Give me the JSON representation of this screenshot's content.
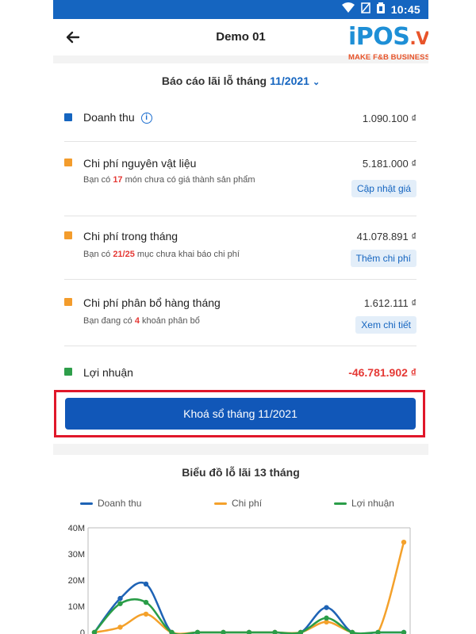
{
  "status_bar": {
    "time": "10:45"
  },
  "app_bar": {
    "title": "Demo 01"
  },
  "brand": {
    "logo_i": "i",
    "logo_pos": "POS",
    "logo_vn": ".VN",
    "tagline": "MAKE F&B BUSINESS BETTER"
  },
  "report": {
    "title": "Báo cáo lãi lỗ tháng",
    "month": "11/2021",
    "rows": [
      {
        "label": "Doanh thu",
        "amount": "1.090.100 ₫",
        "color": "#1565c0"
      },
      {
        "label": "Chi phí nguyên vật liệu",
        "amount": "5.181.000 ₫",
        "color": "#f39c2c",
        "note_pre": "Bạn có ",
        "note_hl": "17",
        "note_post": " món chưa có giá thành sản phẩm",
        "action": "Cập nhật giá"
      },
      {
        "label": "Chi phí trong tháng",
        "amount": "41.078.891 ₫",
        "color": "#f39c2c",
        "note_pre": "Bạn có ",
        "note_hl": "21/25",
        "note_post": " mục chưa khai báo chi phí",
        "action": "Thêm chi phí"
      },
      {
        "label": "Chi phí phân bổ hàng tháng",
        "amount": "1.612.111 ₫",
        "color": "#f39c2c",
        "note_pre": "Bạn đang có ",
        "note_hl": "4",
        "note_post": " khoản phân bổ",
        "action": "Xem chi tiết"
      },
      {
        "label": "Lợi nhuận",
        "amount": "-46.781.902 ₫",
        "color": "#2e9e4a",
        "amount_color": "#e53935"
      }
    ],
    "lock_button": "Khoá sổ tháng 11/2021"
  },
  "chart_data": {
    "type": "line",
    "title": "Biểu đồ lỗ lãi 13 tháng",
    "y_ticks": [
      "40M",
      "30M",
      "20M",
      "10M",
      "0"
    ],
    "ylim": [
      0,
      40
    ],
    "y_unit": "M",
    "x": [
      0,
      1,
      2,
      3,
      4,
      5,
      6,
      7,
      8,
      9,
      10,
      11,
      12
    ],
    "series": [
      {
        "name": "Doanh thu",
        "color": "#1e63b5",
        "values": [
          0,
          13,
          18.5,
          0,
          0,
          0,
          0,
          0,
          0,
          9.5,
          0,
          0,
          0
        ]
      },
      {
        "name": "Chi phí",
        "color": "#f4a12b",
        "values": [
          0,
          2,
          7,
          0,
          0,
          0,
          0,
          0,
          0,
          4,
          0,
          0,
          34.5
        ]
      },
      {
        "name": "Lợi nhuận",
        "color": "#2a9d48",
        "values": [
          0,
          11,
          11.5,
          0,
          0,
          0,
          0,
          0,
          0,
          5.5,
          0,
          0,
          0
        ]
      }
    ],
    "grid": false
  }
}
